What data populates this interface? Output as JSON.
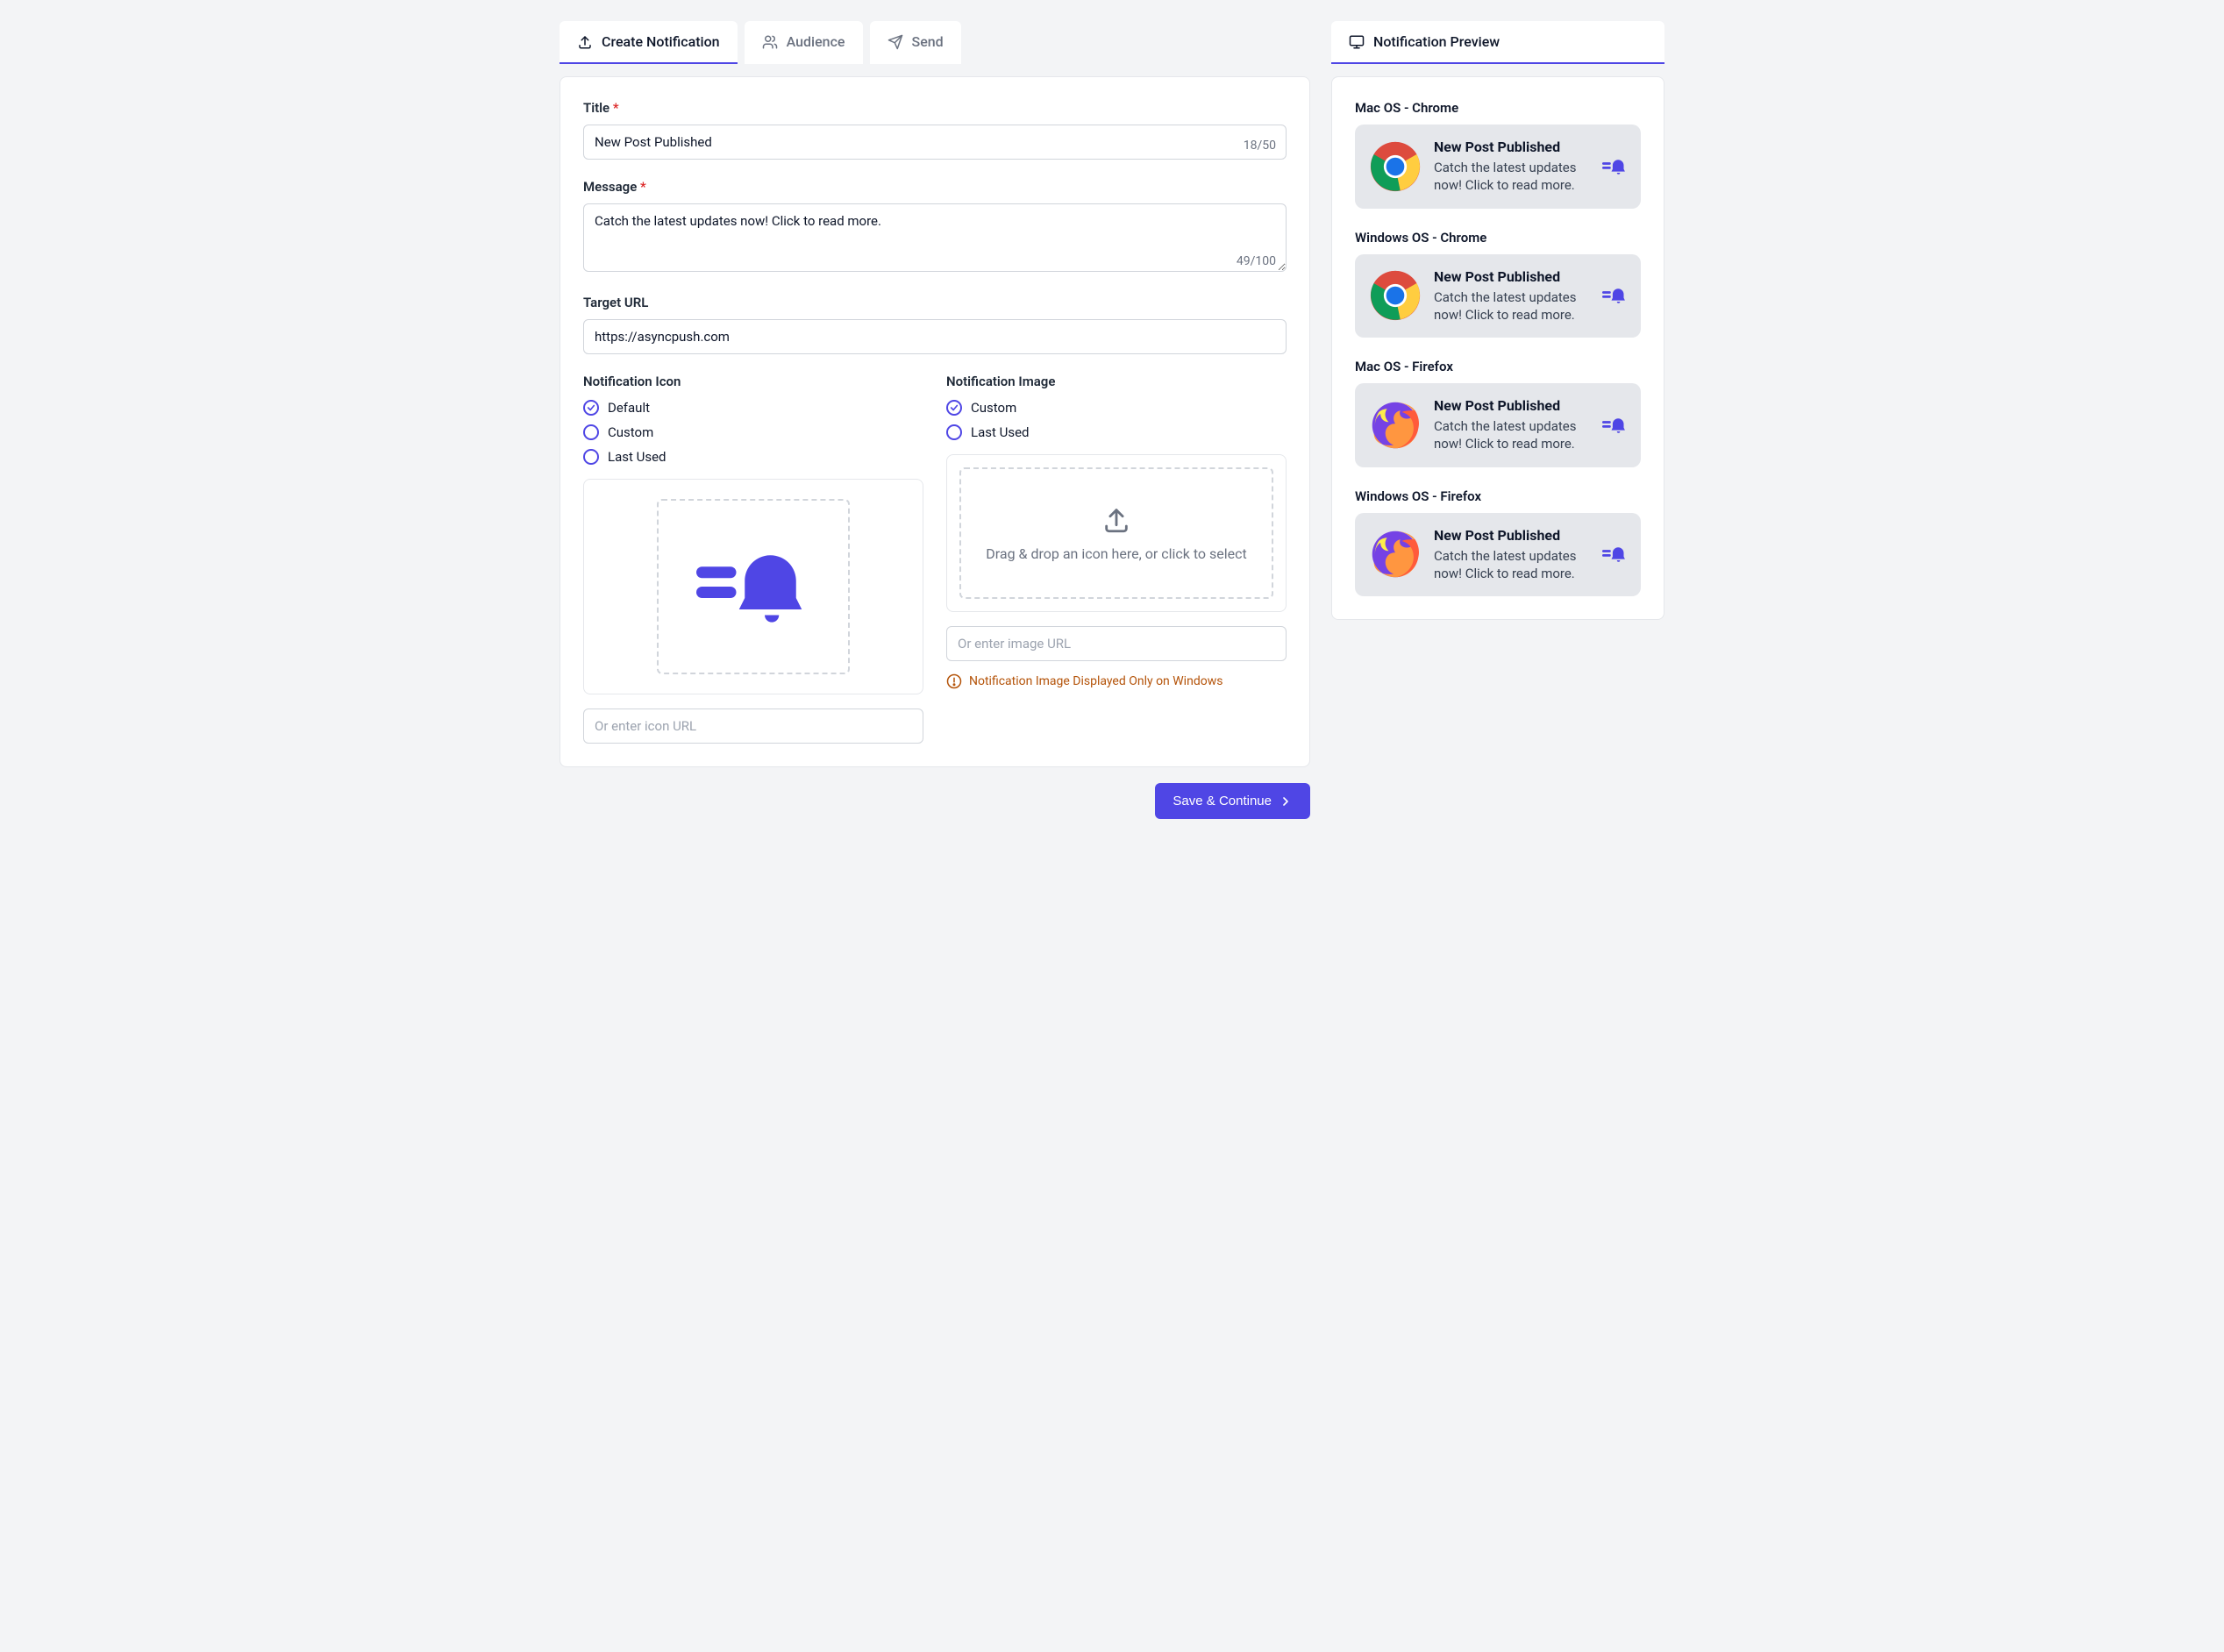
{
  "tabs": {
    "create": "Create Notification",
    "audience": "Audience",
    "send": "Send"
  },
  "form": {
    "title_label": "Title",
    "title_value": "New Post Published",
    "title_counter": "18/50",
    "message_label": "Message",
    "message_value": "Catch the latest updates now! Click to read more.",
    "message_counter": "49/100",
    "target_url_label": "Target URL",
    "target_url_value": "https://asyncpush.com",
    "icon_label": "Notification Icon",
    "icon_options": {
      "default": "Default",
      "custom": "Custom",
      "last_used": "Last Used"
    },
    "icon_url_placeholder": "Or enter icon URL",
    "image_label": "Notification Image",
    "image_options": {
      "custom": "Custom",
      "last_used": "Last Used"
    },
    "image_drop_text": "Drag & drop an icon here, or click to select",
    "image_url_placeholder": "Or enter image URL",
    "image_warning": "Notification Image Displayed Only on Windows"
  },
  "actions": {
    "save_continue": "Save & Continue"
  },
  "preview": {
    "panel_title": "Notification Preview",
    "sections": [
      {
        "label": "Mac OS - Chrome",
        "browser": "chrome"
      },
      {
        "label": "Windows OS - Chrome",
        "browser": "chrome"
      },
      {
        "label": "Mac OS - Firefox",
        "browser": "firefox"
      },
      {
        "label": "Windows OS - Firefox",
        "browser": "firefox"
      }
    ],
    "notif_title": "New Post Published",
    "notif_msg": "Catch the latest updates now! Click to read more."
  }
}
